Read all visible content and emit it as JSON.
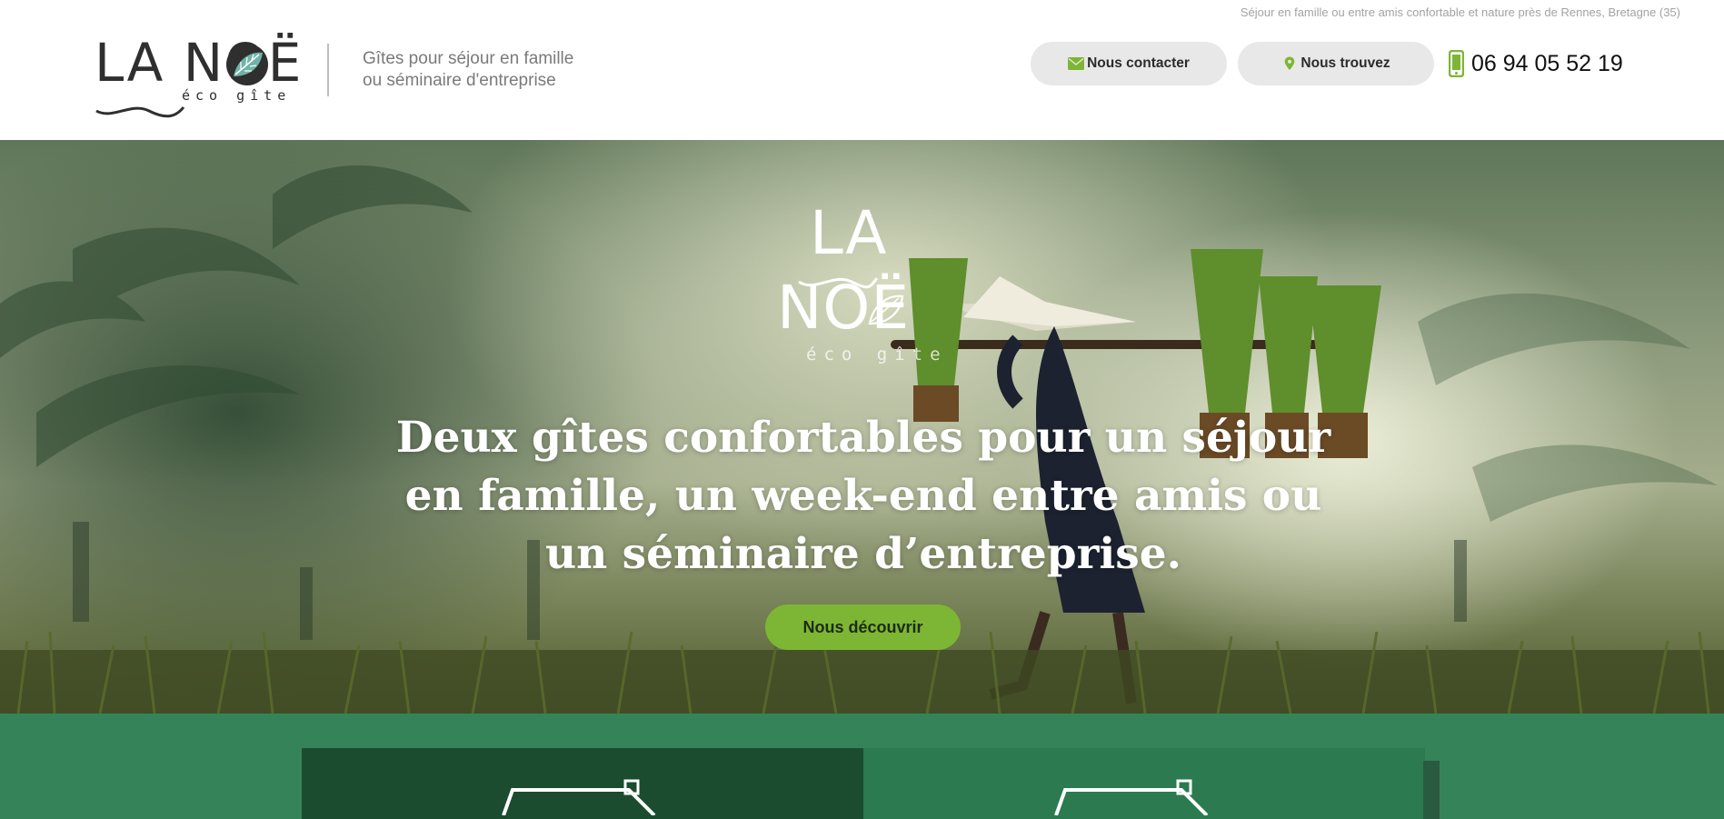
{
  "header": {
    "tagline_top": "Séjour en famille ou entre amis confortable et nature près de Rennes, Bretagne (35)",
    "logo": {
      "word": "LA NOË",
      "sub": "éco gîte"
    },
    "subtitle_line1": "Gîtes pour séjour en famille",
    "subtitle_line2": "ou séminaire d'entreprise",
    "contact_label": "Nous contacter",
    "find_label": "Nous trouvez",
    "phone": "06 94 05 52 19",
    "icons": {
      "contact": "envelope-icon",
      "find": "map-pin-icon",
      "phone": "mobile-phone-icon"
    }
  },
  "hero": {
    "logo": {
      "la": "LA",
      "noe": "NOË",
      "sub": "éco gîte"
    },
    "title": "Deux gîtes confortables pour un séjour en famille, un week-end entre amis ou un séminaire d’entreprise.",
    "cta_label": "Nous découvrir"
  },
  "colors": {
    "accent_green": "#7db634",
    "band_green": "#358459",
    "card_dark": "#1c4c30",
    "card_light": "#2b7a50",
    "pill_grey": "#e8e8e8"
  },
  "features": {
    "icons": [
      "house-icon",
      "house-icon"
    ]
  }
}
